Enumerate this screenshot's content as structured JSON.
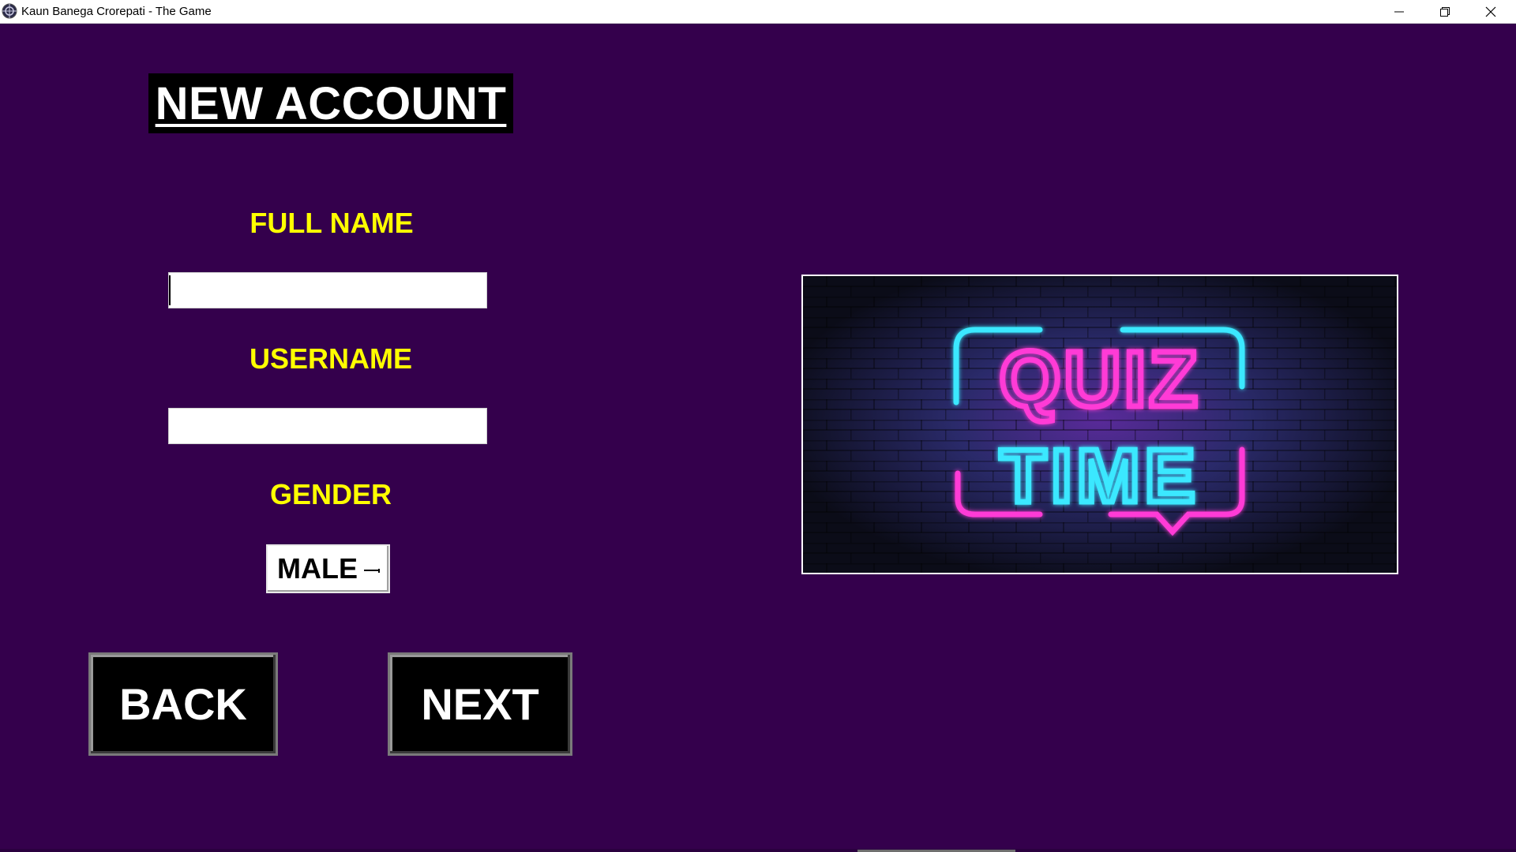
{
  "window": {
    "title": "Kaun Banega Crorepati - The Game",
    "controls": [
      "minimize-icon",
      "restore-icon",
      "close-icon"
    ]
  },
  "form": {
    "heading": "NEW ACCOUNT",
    "full_name_label": "FULL NAME",
    "full_name_value": "",
    "username_label": "USERNAME",
    "username_value": "",
    "gender_label": "GENDER",
    "gender_selected": "MALE",
    "back_label": "BACK",
    "next_label": "NEXT"
  },
  "banner": {
    "line1": "QUIZ",
    "line2": "TIME"
  },
  "colors": {
    "background": "#34004c",
    "label": "#ffff00",
    "button_bg": "#000000",
    "neon_pink": "#ff3ad6",
    "neon_cyan": "#3ae8ff"
  }
}
